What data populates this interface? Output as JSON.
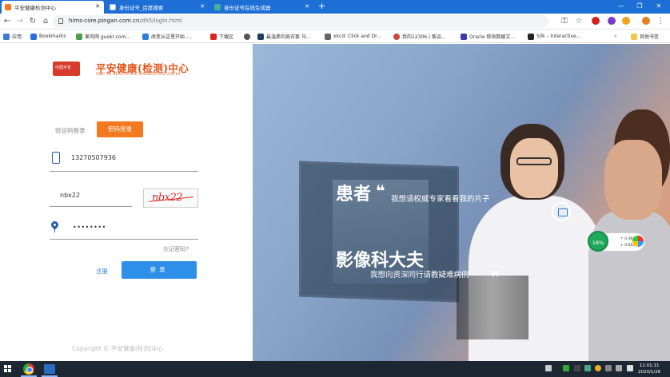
{
  "browser": {
    "tabs": [
      {
        "title": "平安健康检测中心",
        "active": true
      },
      {
        "title": "身份证号_百度搜索",
        "active": false
      },
      {
        "title": "身份证号在线生成器",
        "active": false
      }
    ],
    "url_host": "hims-core.pingan.com.cn",
    "url_path": "/dh5/login.html",
    "bookmarks": [
      "应用",
      "Bookmarks",
      "果壳网 guokr.com...",
      "改变从这里开始 -...",
      "下载区",
      "最温柔的斑衣客 马...",
      "xkcd: Click and Dr...",
      "我的12306 | 客运...",
      "Oracle 修改数据文...",
      "Silk – Interactive...",
      "其他书签"
    ],
    "bookmarks_more": "»",
    "new_tab": "+",
    "window_controls": {
      "minimize": "—",
      "restore": "❐",
      "close": "✕"
    },
    "tab_close": "✕"
  },
  "brand": {
    "badge_text": "中国平安",
    "title": "平安健康(检测)中心",
    "subtitle": "PING AN HEALTHCARE DIAGNOSTICS CENTER"
  },
  "login": {
    "tab_sms": "验证码登录",
    "tab_password": "密码登录",
    "phone_value": "13270507936",
    "captcha_input_value": "nbx22",
    "captcha_image_text": "nbx22",
    "password_value": "••••••••",
    "forgot_label": "忘记密码?",
    "register_label": "注册",
    "submit_label": "登录"
  },
  "banner": {
    "headline1": "患者",
    "quote_open": "❝",
    "subline1": "我想请权威专家看看我的片子",
    "headline2": "影像科大夫",
    "subline2": "我想向资深同行请教疑难病例",
    "quote_close": "❞"
  },
  "net_widget": {
    "percent": "18%",
    "upload": "↑ 0.4K/s",
    "download": "↓ 0.6K/s"
  },
  "footer": {
    "copyright": "Copyright © 平安健康(检测)中心"
  },
  "taskbar": {
    "time": "11:01:11",
    "date": "2020/1/26"
  }
}
